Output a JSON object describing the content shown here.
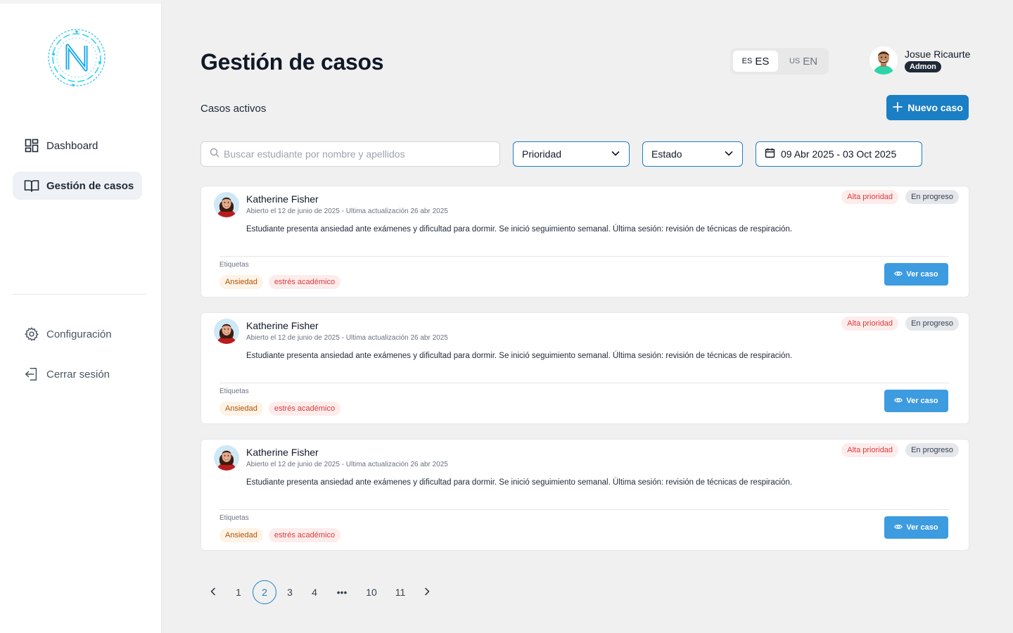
{
  "sidebar": {
    "items": [
      {
        "label": "Dashboard",
        "icon": "dashboard-icon"
      },
      {
        "label": "Gestión de casos",
        "icon": "book-icon",
        "active": true
      }
    ],
    "bottom_items": [
      {
        "label": "Configuración",
        "icon": "gear-icon"
      },
      {
        "label": "Cerrar sesión",
        "icon": "logout-icon"
      }
    ]
  },
  "header": {
    "title": "Gestión de casos",
    "languages": [
      {
        "code": "ES",
        "flag": "ES",
        "active": true
      },
      {
        "code": "EN",
        "flag": "US",
        "active": false
      }
    ],
    "user": {
      "name": "Josue Ricaurte",
      "role": "Admon"
    }
  },
  "toolbar": {
    "subtitle": "Casos activos",
    "new_case_label": "Nuevo caso",
    "search_placeholder": "Buscar estudiante por nombre y apellidos",
    "priority_label": "Prioridad",
    "status_label": "Estado",
    "date_range": "09 Abr 2025 - 03 Oct 2025"
  },
  "cases": [
    {
      "name": "Katherine Fisher",
      "meta": "Abierto el 12 de junio de 2025 - Ultima actualización 26 abr 2025",
      "description": "Estudiante presenta ansiedad ante exámenes y dificultad para dormir. Se inició seguimiento semanal. Última sesión: revisión de técnicas de respiración.",
      "priority": "Alta prioridad",
      "status": "En progreso",
      "tags_label": "Etiquetas",
      "tags": [
        "Ansiedad",
        "estrés académico"
      ],
      "view_label": "Ver caso"
    },
    {
      "name": "Katherine Fisher",
      "meta": "Abierto el 12 de junio de 2025 - Ultima actualización 26 abr 2025",
      "description": "Estudiante presenta ansiedad ante exámenes y dificultad para dormir. Se inició seguimiento semanal. Última sesión: revisión de técnicas de respiración.",
      "priority": "Alta prioridad",
      "status": "En progreso",
      "tags_label": "Etiquetas",
      "tags": [
        "Ansiedad",
        "estrés académico"
      ],
      "view_label": "Ver caso"
    },
    {
      "name": "Katherine Fisher",
      "meta": "Abierto el 12 de junio de 2025 - Ultima actualización 26 abr 2025",
      "description": "Estudiante presenta ansiedad ante exámenes y dificultad para dormir. Se inició seguimiento semanal. Última sesión: revisión de técnicas de respiración.",
      "priority": "Alta prioridad",
      "status": "En progreso",
      "tags_label": "Etiquetas",
      "tags": [
        "Ansiedad",
        "estrés académico"
      ],
      "view_label": "Ver caso"
    }
  ],
  "pagination": {
    "pages": [
      "1",
      "2",
      "3",
      "4",
      "•••",
      "10",
      "11"
    ],
    "current": "2"
  },
  "colors": {
    "primary": "#1a7fc4",
    "view_button": "#3d9be0",
    "priority_text": "#dc3b3b",
    "background": "#f0f0f0"
  }
}
